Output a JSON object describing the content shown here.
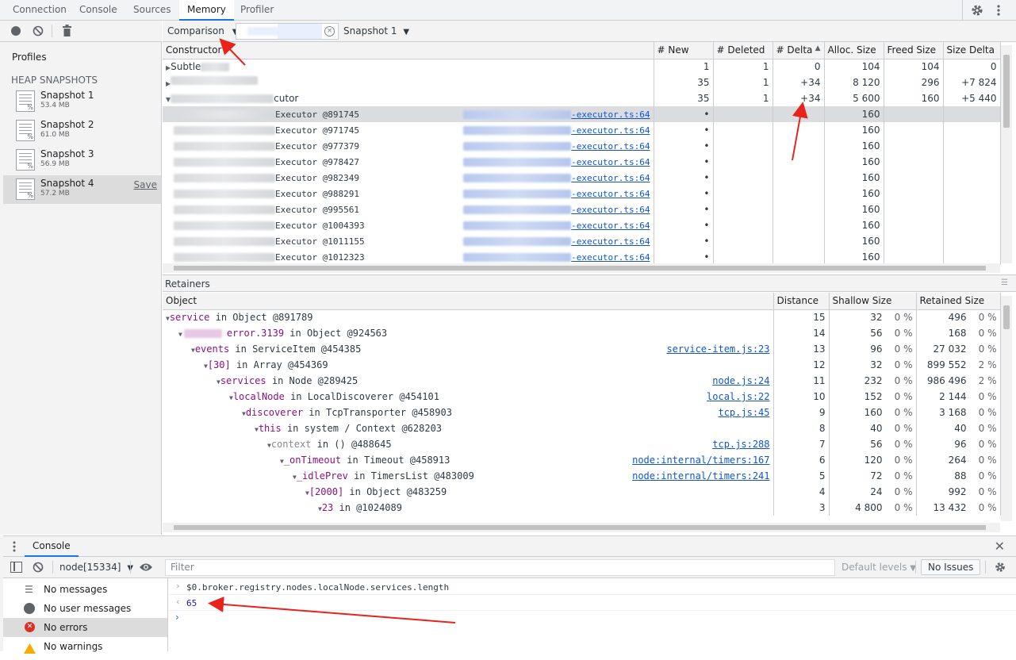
{
  "tabs": [
    "Connection",
    "Console",
    "Sources",
    "Memory",
    "Profiler"
  ],
  "active_tab": "Memory",
  "sidebar": {
    "profiles_title": "Profiles",
    "section_title": "HEAP SNAPSHOTS",
    "snapshots": [
      {
        "name": "Snapshot 1",
        "size": "53.4 MB"
      },
      {
        "name": "Snapshot 2",
        "size": "61.0 MB"
      },
      {
        "name": "Snapshot 3",
        "size": "56.9 MB"
      },
      {
        "name": "Snapshot 4",
        "size": "57.2 MB",
        "action": "Save"
      }
    ]
  },
  "toolbar": {
    "view_mode": "Comparison",
    "base_snapshot": "Snapshot 1"
  },
  "constructors": {
    "columns": [
      "Constructor",
      "# New",
      "# Deleted",
      "# Delta",
      "Alloc. Size",
      "Freed Size",
      "Size Delta"
    ],
    "group_rows": [
      {
        "name": "Subtle",
        "new": "1",
        "deleted": "1",
        "delta": "0",
        "alloc": "104",
        "freed": "104",
        "size_delta": "0"
      },
      {
        "name": "",
        "new": "35",
        "deleted": "1",
        "delta": "+34",
        "alloc": "8 120",
        "freed": "296",
        "size_delta": "+7 824"
      },
      {
        "name": "cutor",
        "new": "35",
        "deleted": "1",
        "delta": "+34",
        "alloc": "5 600",
        "freed": "160",
        "size_delta": "+5 440"
      }
    ],
    "instances": [
      {
        "id": "Executor @891745",
        "source": "-executor.ts:64",
        "new": "•",
        "alloc": "160"
      },
      {
        "id": "Executor @971745",
        "source": "-executor.ts:64",
        "new": "•",
        "alloc": "160"
      },
      {
        "id": "Executor @977379",
        "source": "-executor.ts:64",
        "new": "•",
        "alloc": "160"
      },
      {
        "id": "Executor @978427",
        "source": "-executor.ts:64",
        "new": "•",
        "alloc": "160"
      },
      {
        "id": "Executor @982349",
        "source": "-executor.ts:64",
        "new": "•",
        "alloc": "160"
      },
      {
        "id": "Executor @988291",
        "source": "-executor.ts:64",
        "new": "•",
        "alloc": "160"
      },
      {
        "id": "Executor @995561",
        "source": "-executor.ts:64",
        "new": "•",
        "alloc": "160"
      },
      {
        "id": "Executor @1004393",
        "source": "-executor.ts:64",
        "new": "•",
        "alloc": "160"
      },
      {
        "id": "Executor @1011155",
        "source": "-executor.ts:64",
        "new": "•",
        "alloc": "160"
      },
      {
        "id": "Executor @1012323",
        "source": "-executor.ts:64",
        "new": "•",
        "alloc": "160"
      }
    ]
  },
  "retainers": {
    "title": "Retainers",
    "columns": [
      "Object",
      "Distance",
      "Shallow Size",
      "Retained Size"
    ],
    "rows": [
      {
        "prop": "service",
        "rest": " in Object @891789",
        "source": "",
        "distance": "15",
        "shallow": "32",
        "shallow_pct": "0 %",
        "retained": "496",
        "retained_pct": "0 %"
      },
      {
        "prop": "error.3139",
        "rest": " in Object @924563",
        "source": "",
        "distance": "14",
        "shallow": "56",
        "shallow_pct": "0 %",
        "retained": "168",
        "retained_pct": "0 %"
      },
      {
        "prop": "events",
        "rest": " in ServiceItem @454385",
        "source": "service-item.js:23",
        "distance": "13",
        "shallow": "96",
        "shallow_pct": "0 %",
        "retained": "27 032",
        "retained_pct": "0 %"
      },
      {
        "prop": "[30]",
        "rest": " in Array @454369",
        "source": "",
        "distance": "12",
        "shallow": "32",
        "shallow_pct": "0 %",
        "retained": "899 552",
        "retained_pct": "2 %"
      },
      {
        "prop": "services",
        "rest": " in Node @289425",
        "source": "node.js:24",
        "distance": "11",
        "shallow": "232",
        "shallow_pct": "0 %",
        "retained": "986 496",
        "retained_pct": "2 %"
      },
      {
        "prop": "localNode",
        "rest": " in LocalDiscoverer @454101",
        "source": "local.js:22",
        "distance": "10",
        "shallow": "152",
        "shallow_pct": "0 %",
        "retained": "2 144",
        "retained_pct": "0 %"
      },
      {
        "prop": "discoverer",
        "rest": " in TcpTransporter @458903",
        "source": "tcp.js:45",
        "distance": "9",
        "shallow": "160",
        "shallow_pct": "0 %",
        "retained": "3 168",
        "retained_pct": "0 %"
      },
      {
        "prop": "this",
        "rest": " in system / Context @628203",
        "source": "",
        "distance": "8",
        "shallow": "40",
        "shallow_pct": "0 %",
        "retained": "40",
        "retained_pct": "0 %"
      },
      {
        "prop": "context",
        "rest": " in () @488645",
        "source": "tcp.js:288",
        "distance": "7",
        "shallow": "56",
        "shallow_pct": "0 %",
        "retained": "96",
        "retained_pct": "0 %"
      },
      {
        "prop": "_onTimeout",
        "rest": " in Timeout @458913",
        "source": "node:internal/timers:167",
        "distance": "6",
        "shallow": "120",
        "shallow_pct": "0 %",
        "retained": "264",
        "retained_pct": "0 %"
      },
      {
        "prop": "_idlePrev",
        "rest": " in TimersList @483009",
        "source": "node:internal/timers:241",
        "distance": "5",
        "shallow": "72",
        "shallow_pct": "0 %",
        "retained": "88",
        "retained_pct": "0 %"
      },
      {
        "prop": "[2000]",
        "rest": " in Object @483259",
        "source": "",
        "distance": "4",
        "shallow": "24",
        "shallow_pct": "0 %",
        "retained": "992",
        "retained_pct": "0 %"
      },
      {
        "prop": "23",
        "rest": " in  @1024089",
        "source": "",
        "distance": "3",
        "shallow": "4 800",
        "shallow_pct": "0 %",
        "retained": "13 432",
        "retained_pct": "0 %"
      }
    ]
  },
  "console": {
    "tab_label": "Console",
    "context": "node[15334]",
    "filter_placeholder": "Filter",
    "levels": "Default levels",
    "issues": "No Issues",
    "sidebar": [
      "No messages",
      "No user messages",
      "No errors",
      "No warnings"
    ],
    "input_line": "$0.broker.registry.nodes.localNode.services.length",
    "result": "65"
  },
  "colors": {
    "accent": "#1a73e8",
    "annotation": "#e8231c"
  }
}
